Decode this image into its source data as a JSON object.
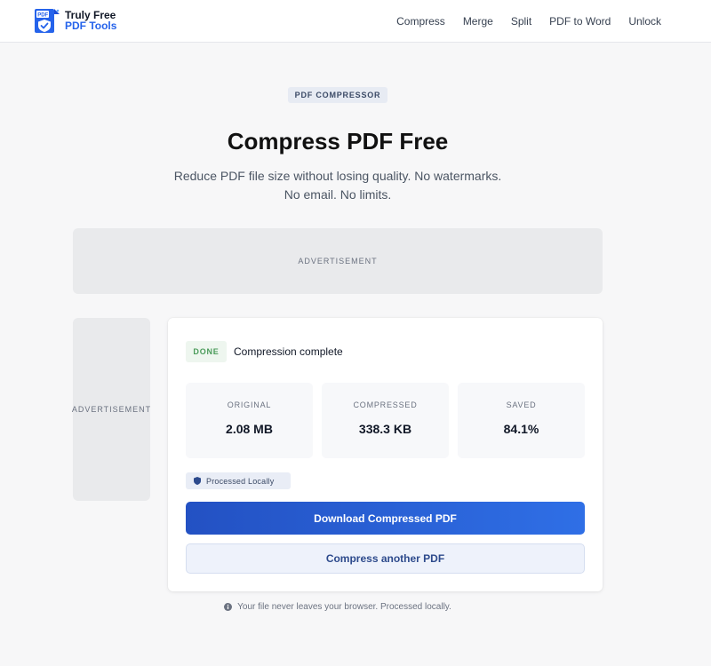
{
  "brand": {
    "line1": "Truly Free",
    "line2": "PDF Tools",
    "logo_glyph": "PDF",
    "logo_icon": "shield-check-icon",
    "colors": {
      "primary": "#2563eb",
      "dark": "#111827"
    }
  },
  "nav": {
    "items": [
      {
        "label": "Compress"
      },
      {
        "label": "Merge"
      },
      {
        "label": "Split"
      },
      {
        "label": "PDF to Word"
      },
      {
        "label": "Unlock"
      }
    ]
  },
  "hero": {
    "badge": "PDF COMPRESSOR",
    "title": "Compress PDF Free",
    "subtitle": "Reduce PDF file size without losing quality. No watermarks. No email. No limits."
  },
  "ads": {
    "top_label": "ADVERTISEMENT",
    "side_label": "ADVERTISEMENT"
  },
  "result": {
    "status_badge": "DONE",
    "status_text": "Compression complete",
    "stats": [
      {
        "label": "ORIGINAL",
        "value": "2.08 MB"
      },
      {
        "label": "COMPRESSED",
        "value": "338.3 KB"
      },
      {
        "label": "SAVED",
        "value": "84.1%"
      }
    ],
    "local_badge": "Processed Locally",
    "download_button": "Download Compressed PDF",
    "again_button": "Compress another PDF",
    "colors": {
      "success": "#4a9b5a",
      "accent": "#2351c3"
    }
  },
  "footer": {
    "note": "Your file never leaves your browser. Processed locally.",
    "icon": "info-icon"
  }
}
